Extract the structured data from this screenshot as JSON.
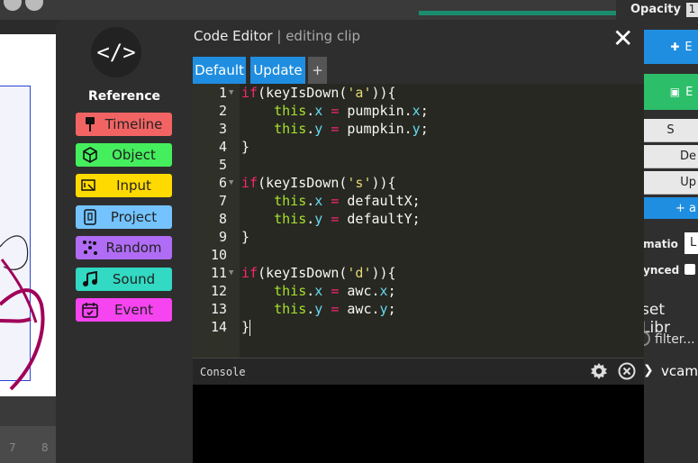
{
  "background": {
    "timeline_numbers": [
      "7",
      "8"
    ]
  },
  "right_panel": {
    "opacity_label": "Opacity",
    "opacity_value": "1",
    "btn1_label": "E",
    "btn2_label": "E",
    "btn3_label": "S",
    "default_label": "De",
    "update_label": "Up",
    "add_label": "+ a",
    "animation_label": "imatio",
    "animation_value": "L",
    "synced_label": "ynced",
    "asset_library_label": "set Libr",
    "filter_placeholder": "filter...",
    "asset_item": "vcam."
  },
  "editor": {
    "title": "Code Editor",
    "subtitle": "editing clip",
    "tabs": [
      "Default",
      "Update"
    ],
    "add_tab": "+",
    "console_label": "Console"
  },
  "reference": {
    "logo_text": "</>",
    "heading": "Reference",
    "items": [
      {
        "label": "Timeline",
        "color": "#f26464"
      },
      {
        "label": "Object",
        "color": "#44ee5d"
      },
      {
        "label": "Input",
        "color": "#ffda00"
      },
      {
        "label": "Project",
        "color": "#74c3ff"
      },
      {
        "label": "Random",
        "color": "#b06cf5"
      },
      {
        "label": "Sound",
        "color": "#32d9c3"
      },
      {
        "label": "Event",
        "color": "#f544f0"
      }
    ]
  },
  "code": {
    "line_numbers": [
      "1",
      "2",
      "3",
      "4",
      "5",
      "6",
      "7",
      "8",
      "9",
      "10",
      "11",
      "12",
      "13",
      "14"
    ],
    "lines": [
      "if(keyIsDown('a')){",
      "    this.x = pumpkin.x;",
      "    this.y = pumpkin.y;",
      "}",
      "",
      "if(keyIsDown('s')){",
      "    this.x = defaultX;",
      "    this.y = defaultY;",
      "}",
      "",
      "if(keyIsDown('d')){",
      "    this.x = awc.x;",
      "    this.y = awc.y;",
      "}"
    ],
    "tokens": {
      "if": "if",
      "open": "(keyIsDown(",
      "close": ")){",
      "key_a": "'a'",
      "key_s": "'s'",
      "key_d": "'d'",
      "indent": "    ",
      "this": "this",
      "dot_x": ".x",
      "dot_y": ".y",
      "x": "x",
      "y": "y",
      "eq": " = ",
      "semi": ";",
      "brace": "}",
      "pumpkin": "pumpkin",
      "awc": "awc",
      "dot": ".",
      "defaultX": "defaultX",
      "defaultY": "defaultY"
    }
  },
  "colors": {
    "tab_blue": "#1f8ee0",
    "editor_bg": "#272822",
    "keyword": "#f92672",
    "this_kw": "#a6e22e",
    "string": "#e6db74",
    "property": "#66d9ef"
  }
}
